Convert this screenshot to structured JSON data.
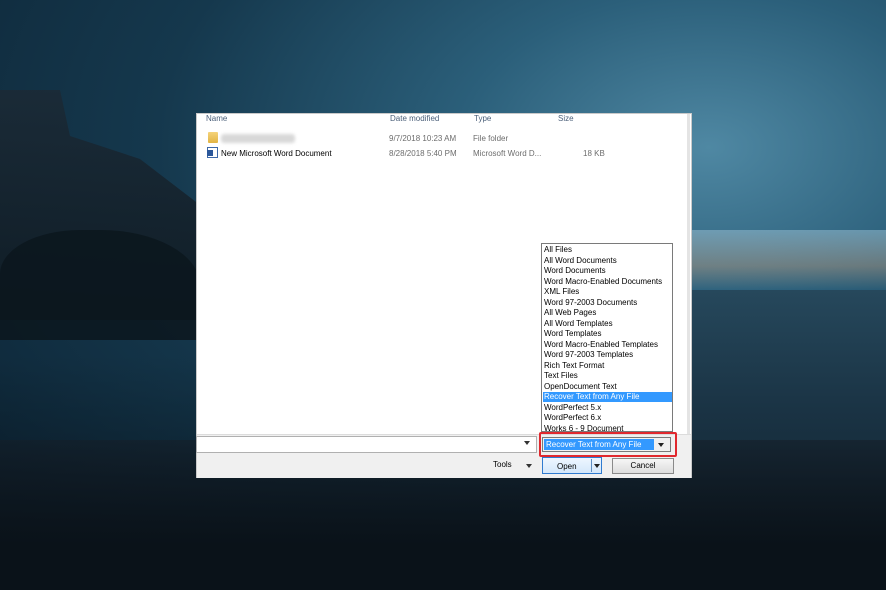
{
  "columns": {
    "name": "Name",
    "date_modified": "Date modified",
    "type": "Type",
    "size": "Size"
  },
  "files": [
    {
      "name": "",
      "date": "9/7/2018 10:23 AM",
      "type": "File folder",
      "size": "",
      "icon": "folder-icon"
    },
    {
      "name": "New Microsoft Word Document",
      "date": "8/28/2018 5:40 PM",
      "type": "Microsoft Word D...",
      "size": "18 KB",
      "icon": "word-document-icon"
    }
  ],
  "file_types": [
    "All Files",
    "All Word Documents",
    "Word Documents",
    "Word Macro-Enabled Documents",
    "XML Files",
    "Word 97-2003 Documents",
    "All Web Pages",
    "All Word Templates",
    "Word Templates",
    "Word Macro-Enabled Templates",
    "Word 97-2003 Templates",
    "Rich Text Format",
    "Text Files",
    "OpenDocument Text",
    "Recover Text from Any File",
    "WordPerfect 5.x",
    "WordPerfect 6.x",
    "Works 6 - 9 Document"
  ],
  "selected_file_type": "Recover Text from Any File",
  "buttons": {
    "tools": "Tools",
    "open": "Open",
    "cancel": "Cancel"
  },
  "colors": {
    "selection": "#3399ff",
    "highlight": "#e0282e"
  }
}
